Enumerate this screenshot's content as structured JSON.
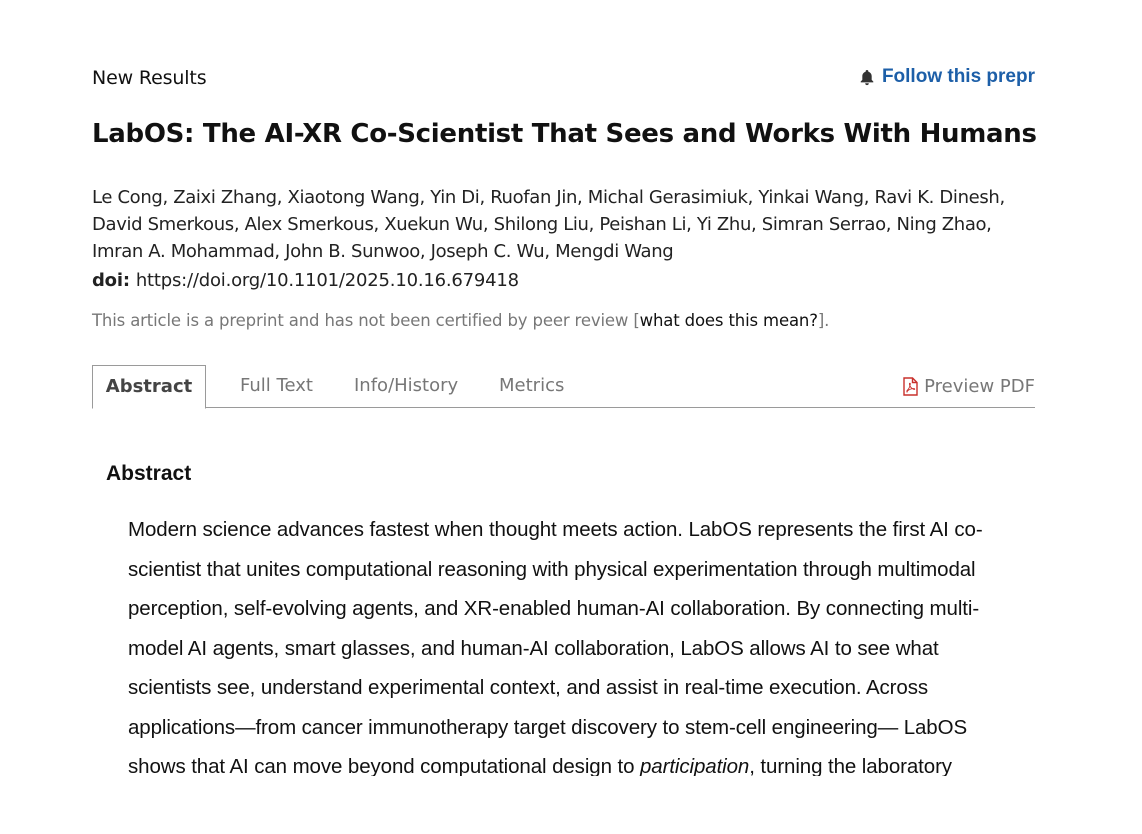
{
  "header": {
    "section_label": "New Results",
    "follow_label": "Follow this prepr",
    "follow_icon": "bell-icon",
    "link_color": "#1d5fa8"
  },
  "article": {
    "title": "LabOS: The AI-XR Co-Scientist That Sees and Works With Humans",
    "authors": [
      "Le Cong",
      "Zaixi Zhang",
      "Xiaotong Wang",
      "Yin Di",
      "Ruofan Jin",
      "Michal Gerasimiuk",
      "Yinkai Wang",
      "Ravi K. Dinesh",
      "David Smerkous",
      "Alex Smerkous",
      "Xuekun Wu",
      "Shilong Liu",
      "Peishan Li",
      "Yi Zhu",
      "Simran Serrao",
      "Ning Zhao",
      "Imran A. Mohammad",
      "John B. Sunwoo",
      "Joseph C. Wu",
      "Mengdi Wang"
    ],
    "doi_label": "doi:",
    "doi": "https://doi.org/10.1101/2025.10.16.679418",
    "peer_note_prefix": "This article is a preprint and has not been certified by peer review [",
    "peer_note_link": "what does this mean?",
    "peer_note_suffix": "]."
  },
  "tabs": {
    "active": "Abstract",
    "items": [
      "Abstract",
      "Full Text",
      "Info/History",
      "Metrics"
    ],
    "preview_pdf": "Preview PDF"
  },
  "abstract": {
    "heading": "Abstract",
    "lines": [
      "Modern science advances fastest when thought meets action. LabOS represents the first AI co-",
      "scientist that unites computational reasoning with physical experimentation through multimodal",
      "perception, self-evolving agents, and XR-enabled human-AI collaboration. By connecting multi-",
      "model AI agents, smart glasses, and human-AI collaboration, LabOS allows AI to see what",
      "scientists see, understand experimental context, and assist in real-time execution. Across",
      "applications—from cancer immunotherapy target discovery to stem-cell engineering— LabOS"
    ],
    "last_line_before": "shows that AI can move beyond computational design to ",
    "last_line_emphasis": "participation",
    "last_line_after": ", turning the laboratory"
  }
}
